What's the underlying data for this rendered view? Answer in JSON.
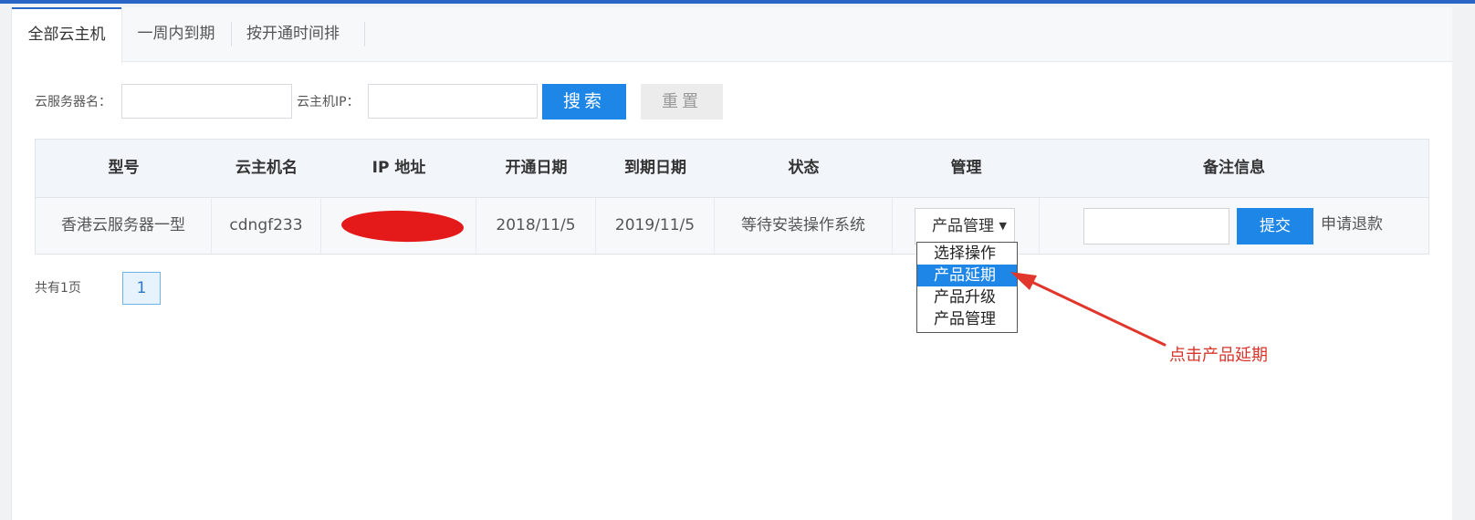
{
  "tabs": [
    {
      "label": "全部云主机",
      "active": true
    },
    {
      "label": "一周内到期",
      "active": false
    },
    {
      "label": "按开通时间排",
      "active": false
    }
  ],
  "search": {
    "server_name_label": "云服务器名：",
    "server_name_value": "",
    "ip_label": "云主机IP：",
    "ip_value": "",
    "search_button": "搜索",
    "reset_button": "重置"
  },
  "table": {
    "headers": [
      "型号",
      "云主机名",
      "IP 地址",
      "开通日期",
      "到期日期",
      "状态",
      "管理",
      "备注信息"
    ],
    "rows": [
      {
        "model": "香港云服务器一型",
        "name": "cdngf233",
        "ip": "",
        "open_date": "2018/11/5",
        "expire_date": "2019/11/5",
        "status": "等待安装操作系统",
        "manage_selected": "产品管理",
        "remark_value": "",
        "submit_label": "提交",
        "refund_label": "申请退款"
      }
    ]
  },
  "dropdown": {
    "options": [
      "选择操作",
      "产品延期",
      "产品升级",
      "产品管理"
    ],
    "highlighted": "产品延期"
  },
  "pagination": {
    "total_label": "共有1页",
    "current_page": "1"
  },
  "annotation": {
    "text": "点击产品延期",
    "color": "#d9342b"
  },
  "colors": {
    "accent": "#1e86e6",
    "top_bar": "#2a67c4",
    "redaction": "#e3191a"
  }
}
